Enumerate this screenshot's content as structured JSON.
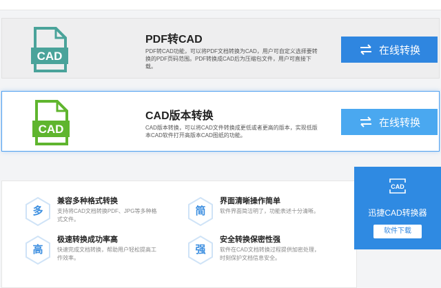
{
  "cards": [
    {
      "icon_name": "cad-file-icon",
      "icon_color": "#4aa39a",
      "icon_text": "CAD",
      "title": "PDF转CAD",
      "description": "PDF转CAD功能，可以将PDF文档转换为CAD，用户可自定义选择要转换的PDF页码范围。PDF转换成CAD后为压缩包文件，用户可直接下载。",
      "button_label": "在线转换"
    },
    {
      "icon_name": "cad-file-icon",
      "icon_color": "#5fb52e",
      "icon_text": "CAD",
      "title": "CAD版本转换",
      "description": "CAD版本转换，可以将CAD文件转换成更低或者更高的版本，实现低版本CAD软件打开高版本CAD图纸的功能。",
      "button_label": "在线转换"
    }
  ],
  "features": [
    {
      "badge": "多",
      "title": "兼容多种格式转换",
      "description": "支持将CAD文档转换PDF、JPG等多种格式文件。"
    },
    {
      "badge": "简",
      "title": "界面清晰操作简单",
      "description": "软件界面简洁明了，功能表述十分清晰。"
    },
    {
      "badge": "高",
      "title": "极速转换成功率高",
      "description": "快速完成文档转换，帮助用户轻松提高工作效率。"
    },
    {
      "badge": "强",
      "title": "安全转换保密性强",
      "description": "软件在CAD文档转换过程提供加密处理，时刻保护文档信息安全。"
    }
  ],
  "sidebar": {
    "logo_text": "CAD",
    "name": "迅捷CAD转换器",
    "download_label": "软件下载"
  },
  "colors": {
    "primary_button": "#2f86e0",
    "accent": "#4d9ff0"
  }
}
